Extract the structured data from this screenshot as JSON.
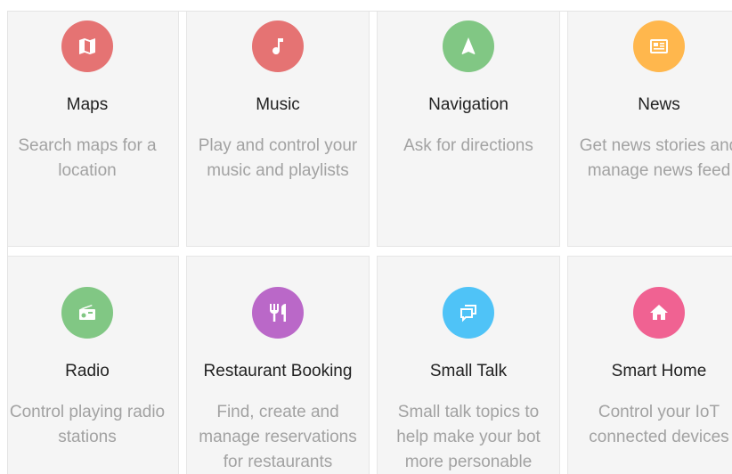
{
  "colors": {
    "maps": "#e57373",
    "music": "#e57373",
    "navigation": "#81c784",
    "news": "#ffb74d",
    "radio": "#81c784",
    "restaurant": "#ba68c8",
    "smalltalk": "#4fc3f7",
    "smarthome": "#f06292"
  },
  "cards": [
    {
      "title": "Maps",
      "icon": "map-icon",
      "desc": [
        "Search maps for a",
        "location"
      ]
    },
    {
      "title": "Music",
      "icon": "music-note-icon",
      "desc": [
        "Play and control your",
        "music and playlists"
      ]
    },
    {
      "title": "Navigation",
      "icon": "navigation-arrow-icon",
      "desc": [
        "Ask for directions"
      ]
    },
    {
      "title": "News",
      "icon": "newspaper-icon",
      "desc": [
        "Get news stories and",
        "manage news feed"
      ]
    },
    {
      "title": "Radio",
      "icon": "radio-icon",
      "desc": [
        "Control playing radio",
        "stations"
      ]
    },
    {
      "title": "Restaurant Booking",
      "icon": "fork-knife-icon",
      "desc": [
        "Find, create and",
        "manage reservations",
        "for restaurants"
      ]
    },
    {
      "title": "Small Talk",
      "icon": "chat-bubbles-icon",
      "desc": [
        "Small talk topics to",
        "help make your bot",
        "more personable"
      ]
    },
    {
      "title": "Smart Home",
      "icon": "home-icon",
      "desc": [
        "Control your IoT",
        "connected devices"
      ]
    }
  ]
}
